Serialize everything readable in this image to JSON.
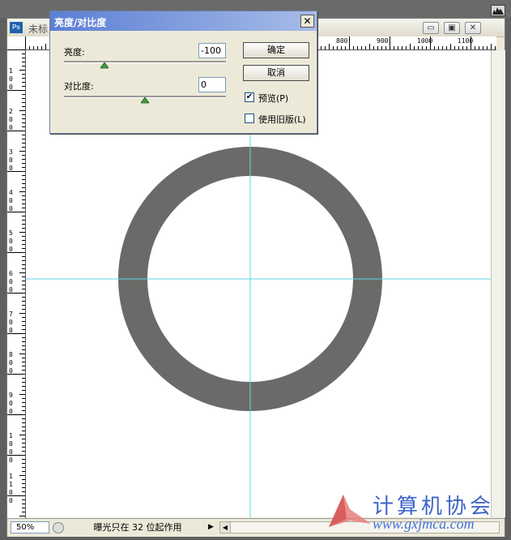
{
  "window": {
    "title": "未标",
    "min_glyph": "▭",
    "restore_glyph": "▣",
    "close_glyph": "✕"
  },
  "ruler": {
    "top_labels": [
      "800",
      "900",
      "1000",
      "1100"
    ],
    "left_labels": [
      [
        "1",
        "0",
        "0"
      ],
      [
        "2",
        "0",
        "0"
      ],
      [
        "3",
        "0",
        "0"
      ],
      [
        "4",
        "0",
        "0"
      ],
      [
        "5",
        "0",
        "0"
      ],
      [
        "6",
        "0",
        "0"
      ],
      [
        "7",
        "0",
        "0"
      ],
      [
        "8",
        "0",
        "0"
      ],
      [
        "9",
        "0",
        "0"
      ],
      [
        "1",
        "0",
        "0",
        "0"
      ],
      [
        "1",
        "1",
        "0",
        "0"
      ]
    ]
  },
  "dialog": {
    "title": "亮度/对比度",
    "close_glyph": "✕",
    "brightness": {
      "label": "亮度:",
      "value": "-100",
      "level": 0.25
    },
    "contrast": {
      "label": "对比度:",
      "value": "0",
      "level": 0.5
    },
    "ok_label": "确定",
    "cancel_label": "取消",
    "preview": {
      "label": "预览(P)",
      "checked": true,
      "check_glyph": "✔"
    },
    "legacy": {
      "label": "使用旧版(L)",
      "checked": false
    }
  },
  "status": {
    "zoom": "50%",
    "message": "曝光只在 32 位起作用",
    "arrow": "▶",
    "scroll_left": "◀"
  },
  "canvas": {
    "ring_color": "#6a6a68",
    "guide_color": "#5ed6e6",
    "background": "#ffffff"
  },
  "watermark": {
    "text": "计算机协会",
    "url": "www.gxjmca.com"
  }
}
